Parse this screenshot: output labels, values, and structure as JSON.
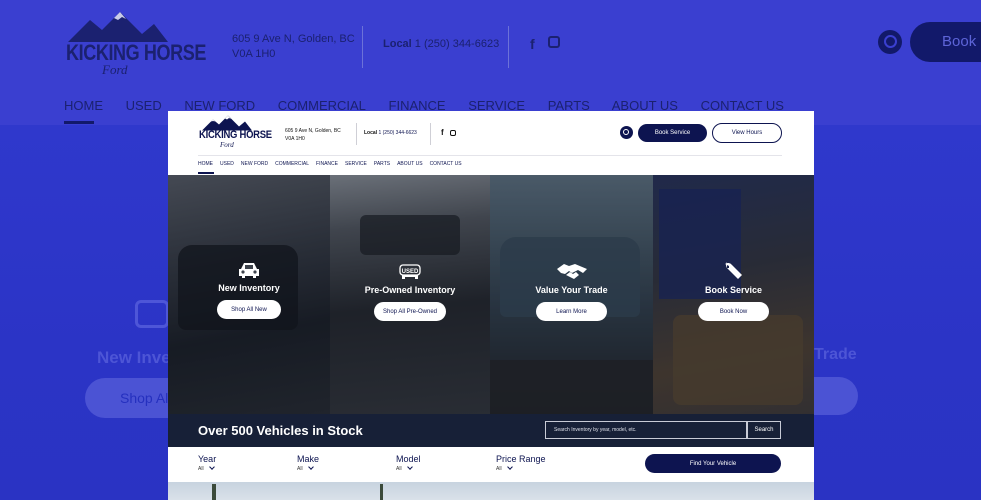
{
  "colors": {
    "brand_navy": "#0d1450",
    "stock_bar": "#172037",
    "backdrop_blue": "#2b34c9"
  },
  "backdrop": {
    "logo": {
      "line1": "KICKING HORSE",
      "line2": "Ford"
    },
    "address": [
      "605 9 Ave N, Golden, BC",
      "V0A 1H0"
    ],
    "local_label": "Local",
    "local_phone": "1 (250) 344-6623",
    "book_button": "Book S",
    "nav": [
      "HOME",
      "USED",
      "NEW FORD",
      "COMMERCIAL",
      "FINANCE",
      "SERVICE",
      "PARTS",
      "ABOUT US",
      "CONTACT US"
    ],
    "hero_left_title": "New Inve",
    "hero_left_button": "Shop All",
    "hero_right_title": "Trade",
    "icons": [
      "facebook-icon",
      "instagram-icon",
      "search-icon",
      "car-icon"
    ]
  },
  "header": {
    "logo": {
      "line1": "KICKING HORSE",
      "line2": "Ford"
    },
    "address": [
      "605 9 Ave N, Golden, BC",
      "V0A 1H0"
    ],
    "local_label": "Local",
    "local_phone": "1 (250) 344-6623",
    "book_service": "Book Service",
    "view_hours": "View Hours",
    "icons": [
      "facebook-icon",
      "instagram-icon",
      "search-icon"
    ]
  },
  "nav": {
    "items": [
      "HOME",
      "USED",
      "NEW FORD",
      "COMMERCIAL",
      "FINANCE",
      "SERVICE",
      "PARTS",
      "ABOUT US",
      "CONTACT US"
    ],
    "active": "HOME"
  },
  "panels": [
    {
      "title": "New Inventory",
      "button": "Shop All New",
      "icon": "car-icon"
    },
    {
      "title": "Pre-Owned Inventory",
      "button": "Shop All Pre-Owned",
      "icon": "used-car-icon",
      "badge": "USED"
    },
    {
      "title": "Value Your Trade",
      "button": "Learn More",
      "icon": "handshake-icon"
    },
    {
      "title": "Book Service",
      "button": "Book Now",
      "icon": "wrench-icon"
    }
  ],
  "stock": {
    "title": "Over 500 Vehicles in Stock",
    "search_placeholder": "Search Inventory by year, model, etc.",
    "search_button": "Search"
  },
  "filters": [
    {
      "label": "Year",
      "value": "All"
    },
    {
      "label": "Make",
      "value": "All"
    },
    {
      "label": "Model",
      "value": "All"
    },
    {
      "label": "Price Range",
      "value": "All"
    }
  ],
  "find_button": "Find Your Vehicle"
}
